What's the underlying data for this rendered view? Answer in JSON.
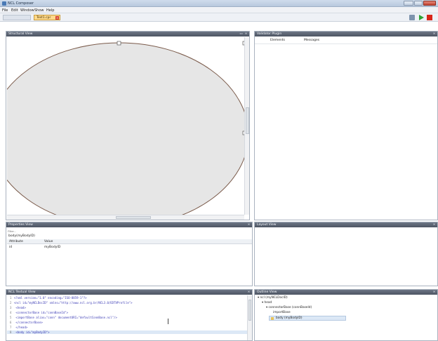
{
  "window": {
    "title": "NCL Composer"
  },
  "menu": [
    "File",
    "Edit",
    "Window",
    "Show",
    "Help"
  ],
  "tabs": {
    "inactive_label": "",
    "active_label": "Test1.cpr"
  },
  "panels": {
    "structural": {
      "title": "Structural View"
    },
    "validation": {
      "title": "Validator Plugin",
      "col_elements": "Elements",
      "col_messages": "Messages"
    },
    "properties": {
      "title": "Properties View",
      "filter_placeholder": "Filter...",
      "selected": "body(myBodyID)",
      "col_attribute": "Attribute",
      "col_value": "Value",
      "rows": [
        {
          "attribute": "id",
          "value": "myBodyID"
        }
      ]
    },
    "layout": {
      "title": "Layout View"
    },
    "textual": {
      "title": "NCL Textual View",
      "lines": [
        {
          "n": "1",
          "text": "<?xml version=\"1.0\" encoding=\"ISO-8859-1\"?>"
        },
        {
          "n": "2",
          "text": "<ncl id=\"myNCLDocID\" xmlns=\"http://www.ncl.org.br/NCL3.0/EDTVProfile\">"
        },
        {
          "n": "3",
          "text": "  <head>"
        },
        {
          "n": "4",
          "text": "    <connectorBase id=\"connBaseId\">"
        },
        {
          "n": "5",
          "text": "      <importBase alias=\"conn\" documentURI=\"defaultConnBase.ncl\"/>"
        },
        {
          "n": "6",
          "text": "    </connectorBase>"
        },
        {
          "n": "7",
          "text": "  </head>"
        },
        {
          "n": "8",
          "text": "  <body id=\"myBodyID\">"
        }
      ]
    },
    "outline": {
      "title": "Outline View",
      "items": [
        {
          "text": "▾ ncl (myNCLDocID)"
        },
        {
          "text": "▾ head"
        },
        {
          "text": "▾ connectorBase (connBaseId)"
        },
        {
          "text": "importBase"
        },
        {
          "text": "body (myBodyID)"
        }
      ]
    }
  },
  "colors": {
    "ellipse_fill": "#e6e6e6",
    "ellipse_stroke": "#7a5a4a",
    "panel_header": "#5a6272",
    "selection": "#dce8f6"
  }
}
